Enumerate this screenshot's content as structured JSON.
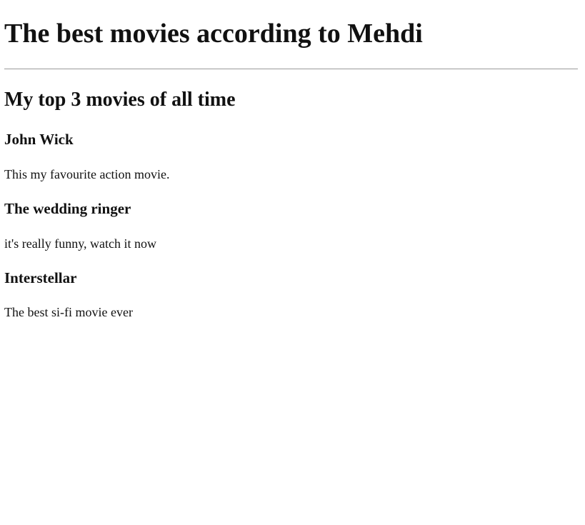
{
  "page": {
    "title": "The best movies according to Mehdi"
  },
  "section": {
    "title": "My top 3 movies of all time"
  },
  "movies": [
    {
      "title": "John Wick",
      "description": "This my favourite action movie."
    },
    {
      "title": "The wedding ringer",
      "description": "it's really funny, watch it now"
    },
    {
      "title": "Interstellar",
      "description": "The best si-fi movie ever"
    }
  ]
}
